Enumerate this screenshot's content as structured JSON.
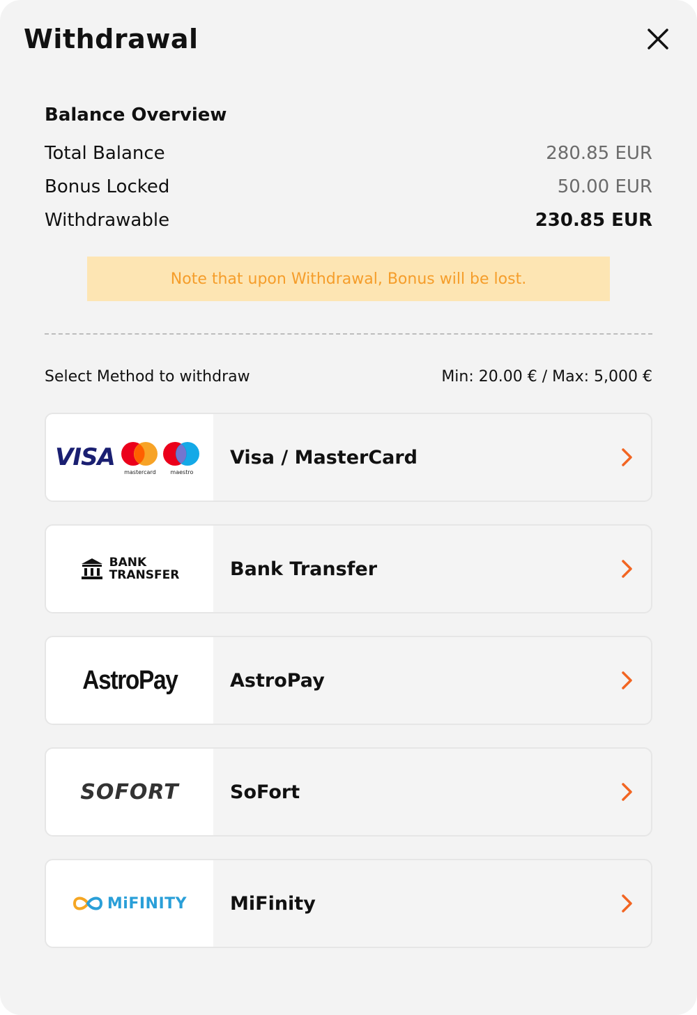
{
  "header": {
    "title": "Withdrawal"
  },
  "balance": {
    "section_title": "Balance Overview",
    "rows": [
      {
        "label": "Total Balance",
        "value": "280.85 EUR"
      },
      {
        "label": "Bonus Locked",
        "value": "50.00 EUR"
      },
      {
        "label": "Withdrawable",
        "value": "230.85 EUR"
      }
    ]
  },
  "notice": "Note that upon Withdrawal, Bonus will be lost.",
  "methods": {
    "header_label": "Select Method to withdraw",
    "limits": "Min: 20.00 € / Max: 5,000 €",
    "items": [
      {
        "name": "Visa / MasterCard",
        "logo_text": "VISA",
        "logo_sub1": "mastercard",
        "logo_sub2": "maestro"
      },
      {
        "name": "Bank Transfer",
        "logo_text1": "BANK",
        "logo_text2": "TRANSFER"
      },
      {
        "name": "AstroPay",
        "logo_text": "AstroPay"
      },
      {
        "name": "SoFort",
        "logo_text": "SOFORT"
      },
      {
        "name": "MiFinity",
        "logo_text": "MiFINITY"
      }
    ]
  },
  "colors": {
    "accent": "#f26522",
    "notice_bg": "#fde5b3",
    "notice_text": "#f59d2a",
    "visa_blue": "#1a1f71",
    "mifinity_blue": "#2a9fd8"
  },
  "icons": {
    "close": "close-icon",
    "chevron": "chevron-right-icon",
    "bank": "bank-building-icon"
  }
}
